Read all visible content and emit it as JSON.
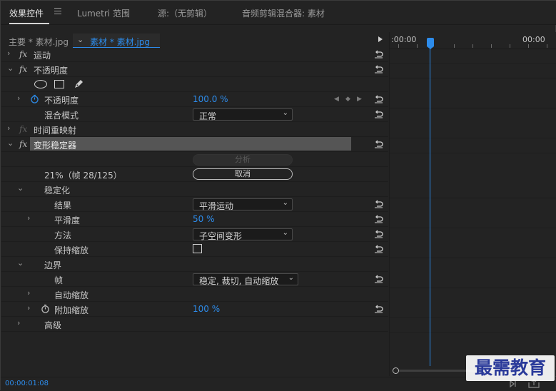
{
  "tabs": [
    {
      "label": "效果控件"
    },
    {
      "label": "Lumetri 范围"
    },
    {
      "label": "源:（无剪辑）"
    },
    {
      "label": "音频剪辑混合器: 素材"
    }
  ],
  "clip_header": {
    "master": "主要 * 素材.jpg",
    "clip": "素材 * 素材.jpg"
  },
  "timeline": {
    "start_tc": ":00:00",
    "end_tc": "00:00"
  },
  "effects": {
    "motion": {
      "label": "运动"
    },
    "opacity": {
      "label": "不透明度"
    },
    "opacity_prop": {
      "label": "不透明度",
      "value": "100.0 %"
    },
    "blend_mode": {
      "label": "混合模式",
      "value": "正常"
    },
    "time_remap": {
      "label": "时间重映射"
    },
    "warp": {
      "label": "变形稳定器"
    },
    "analyze_btn": "分析",
    "progress": "21%（帧 28/125）",
    "cancel_btn": "取消",
    "stabilization": {
      "label": "稳定化"
    },
    "result": {
      "label": "结果",
      "value": "平滑运动"
    },
    "smoothness": {
      "label": "平滑度",
      "value": "50 %"
    },
    "method": {
      "label": "方法",
      "value": "子空间变形"
    },
    "preserve_scale": {
      "label": "保持缩放"
    },
    "borders": {
      "label": "边界"
    },
    "framing": {
      "label": "帧",
      "value": "稳定, 裁切, 自动缩放"
    },
    "auto_scale": {
      "label": "自动缩放"
    },
    "additional_scale": {
      "label": "附加缩放",
      "value": "100 %"
    },
    "advanced": {
      "label": "高级"
    }
  },
  "status": {
    "timecode": "00:00:01:08"
  },
  "watermark": "最需教育",
  "colors": {
    "accent": "#2d8ceb",
    "panel_bg": "#232323",
    "highlight": "#555555"
  }
}
